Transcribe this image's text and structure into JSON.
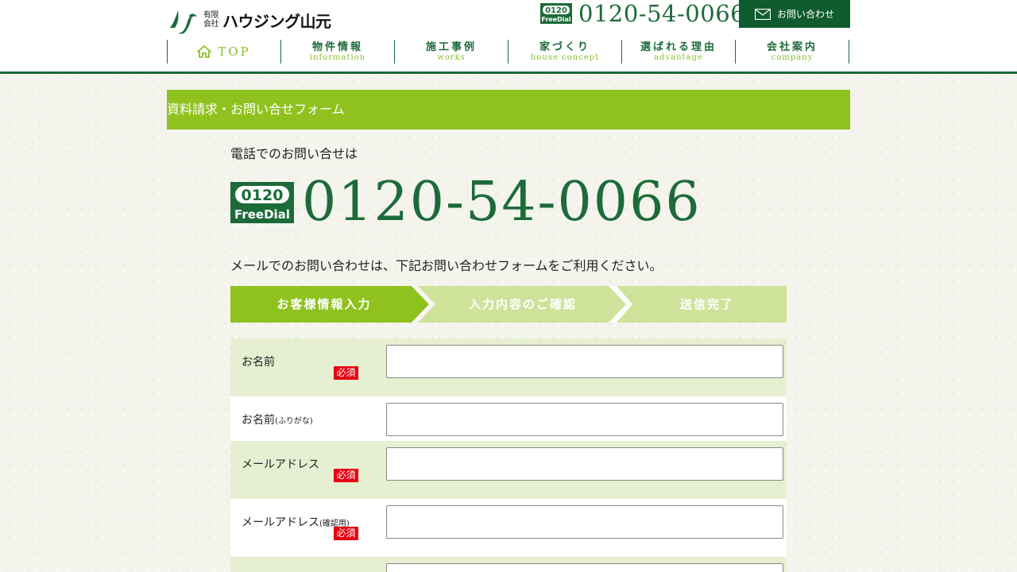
{
  "header": {
    "logo_sub_line1": "有限",
    "logo_sub_line2": "会社",
    "logo_name": "ハウジング山元",
    "phone_number": "0120-54-0066",
    "contact_button_label": "お問い合わせ"
  },
  "nav": {
    "top_label": "TOP",
    "items": [
      {
        "jp": "物件情報",
        "en": "information"
      },
      {
        "jp": "施工事例",
        "en": "works"
      },
      {
        "jp": "家づくり",
        "en": "house concept"
      },
      {
        "jp": "選ばれる理由",
        "en": "advantage"
      },
      {
        "jp": "会社案内",
        "en": "company"
      }
    ]
  },
  "page_title": "資料請求・お問い合せフォーム",
  "phone_section": {
    "lead": "電話でのお問い合せは",
    "number": "0120-54-0066",
    "freedial_top": "0120",
    "freedial_bottom": "FreeDial"
  },
  "mail_lead": "メールでのお問い合わせは、下記お問い合わせフォームをご利用ください。",
  "steps": [
    {
      "label": "お客様情報入力",
      "state": "active"
    },
    {
      "label": "入力内容のご確認",
      "state": "inactive"
    },
    {
      "label": "送信完了",
      "state": "inactive"
    }
  ],
  "form": {
    "required_label": "必須",
    "fields": [
      {
        "label": "お名前",
        "suffix": "",
        "required": true,
        "value": ""
      },
      {
        "label": "お名前",
        "suffix": "(ふりがな)",
        "required": false,
        "value": ""
      },
      {
        "label": "メールアドレス",
        "suffix": "",
        "required": true,
        "value": ""
      },
      {
        "label": "メールアドレス",
        "suffix": "(確認用)",
        "required": true,
        "value": ""
      },
      {
        "label": "",
        "suffix": "",
        "required": false,
        "value": ""
      }
    ]
  },
  "colors": {
    "brand_green": "#1d6b3a",
    "accent_green": "#8fc21f",
    "step_inactive": "#cfe29a",
    "required_red": "#e60012",
    "row_alt": "#e6efd2"
  }
}
